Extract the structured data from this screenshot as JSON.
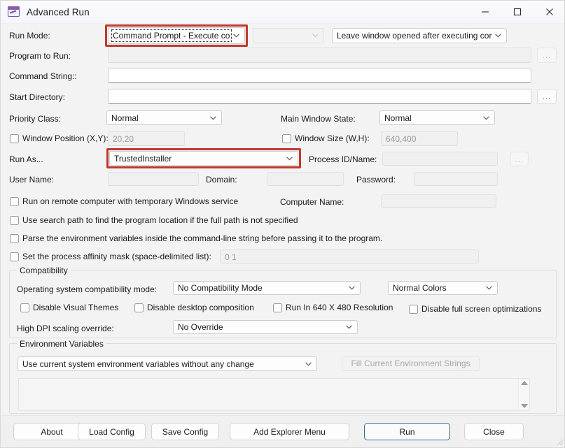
{
  "window": {
    "title": "Advanced Run",
    "icon": "app-window-icon",
    "controls": {
      "minimize": "minimize-icon",
      "maximize": "maximize-icon",
      "close": "close-icon"
    }
  },
  "accent": {
    "highlight_red": "#c0392b",
    "default_button_border": "#3b6c86"
  },
  "form": {
    "run_mode": {
      "label": "Run Mode:",
      "value": "Command Prompt - Execute comman",
      "highlighted": true,
      "secondary_value": "",
      "window_behavior": "Leave window opened after executing comman"
    },
    "program_to_run": {
      "label": "Program to Run:",
      "value": "",
      "browse": "..."
    },
    "command_string": {
      "label": "Command String::",
      "value": ""
    },
    "start_directory": {
      "label": "Start Directory:",
      "value": "",
      "browse": "..."
    },
    "priority_class": {
      "label": "Priority Class:",
      "value": "Normal"
    },
    "main_window_state": {
      "label": "Main Window State:",
      "value": "Normal"
    },
    "window_position": {
      "label": "Window Position (X,Y):",
      "value": "20,20",
      "checked": false
    },
    "window_size": {
      "label": "Window Size (W,H):",
      "value": "640,400",
      "checked": false
    },
    "run_as": {
      "label": "Run As...",
      "value": "TrustedInstaller",
      "highlighted": true
    },
    "process_id": {
      "label": "Process ID/Name:",
      "value": "",
      "browse": "..."
    },
    "user_name": {
      "label": "User Name:",
      "value": ""
    },
    "domain": {
      "label": "Domain:",
      "value": ""
    },
    "password": {
      "label": "Password:",
      "value": ""
    },
    "remote_computer": {
      "label": "Run on remote computer with temporary Windows service",
      "checked": false
    },
    "computer_name": {
      "label": "Computer Name:",
      "value": ""
    },
    "search_path": {
      "label": "Use search path to find the program location if the full path is not specified",
      "checked": false
    },
    "parse_env": {
      "label": "Parse the environment variables inside the command-line string before passing it to the program.",
      "checked": false
    },
    "affinity_mask": {
      "label": "Set the process affinity mask (space-delimited list):",
      "value": "0 1",
      "checked": false
    }
  },
  "compatibility": {
    "caption": "Compatibility",
    "os_mode": {
      "label": "Operating system compatibility mode:",
      "value": "No Compatibility Mode"
    },
    "colors": {
      "value": "Normal Colors"
    },
    "disable_visual_themes": {
      "label": "Disable Visual Themes",
      "checked": false
    },
    "disable_desktop_composition": {
      "label": "Disable desktop composition",
      "checked": false
    },
    "run_640x480": {
      "label": "Run In 640 X 480 Resolution",
      "checked": false
    },
    "disable_fullscreen_opt": {
      "label": "Disable full screen optimizations",
      "checked": false
    },
    "dpi_override": {
      "label": "High DPI scaling override:",
      "value": "No Override"
    }
  },
  "environment": {
    "caption": "Environment Variables",
    "mode": "Use current system environment variables without any change",
    "fill_button": "Fill Current Environment Strings",
    "list_items": [],
    "scrollbar": {
      "up": "scroll-up-arrow",
      "down": "scroll-down-arrow"
    }
  },
  "footer": {
    "about": "About",
    "load_config": "Load Config",
    "save_config": "Save Config",
    "add_explorer_menu": "Add Explorer Menu",
    "run": "Run",
    "close": "Close"
  }
}
